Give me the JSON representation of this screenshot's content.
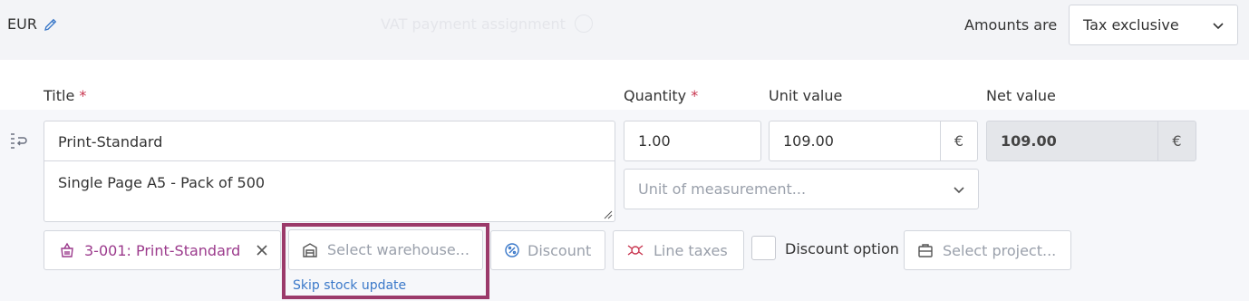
{
  "header": {
    "currency": "EUR",
    "currency_edit_icon": "pencil-icon",
    "ghost_text": "VAT payment assignment",
    "amounts_label": "Amounts are",
    "amounts_value": "Tax exclusive"
  },
  "columns": {
    "title": "Title",
    "quantity": "Quantity",
    "unit_value": "Unit value",
    "net_value": "Net value",
    "required_mark": "*"
  },
  "line": {
    "title": "Print-Standard",
    "description": "Single Page A5 - Pack of 500",
    "quantity": "1.00",
    "unit_value": "109.00",
    "unit_currency": "€",
    "net_value": "109.00",
    "net_currency": "€",
    "uom_placeholder": "Unit of measurement..."
  },
  "chips": {
    "product": "3-001: Print-Standard",
    "warehouse_placeholder": "Select warehouse...",
    "discount": "Discount",
    "line_taxes": "Line taxes",
    "discount_option": "Discount option",
    "project_placeholder": "Select project...",
    "skip_stock": "Skip stock update"
  },
  "colors": {
    "accent": "#9b3a6a",
    "product": "#9b3a8c",
    "link": "#3a78c9",
    "required": "#c8344e"
  }
}
